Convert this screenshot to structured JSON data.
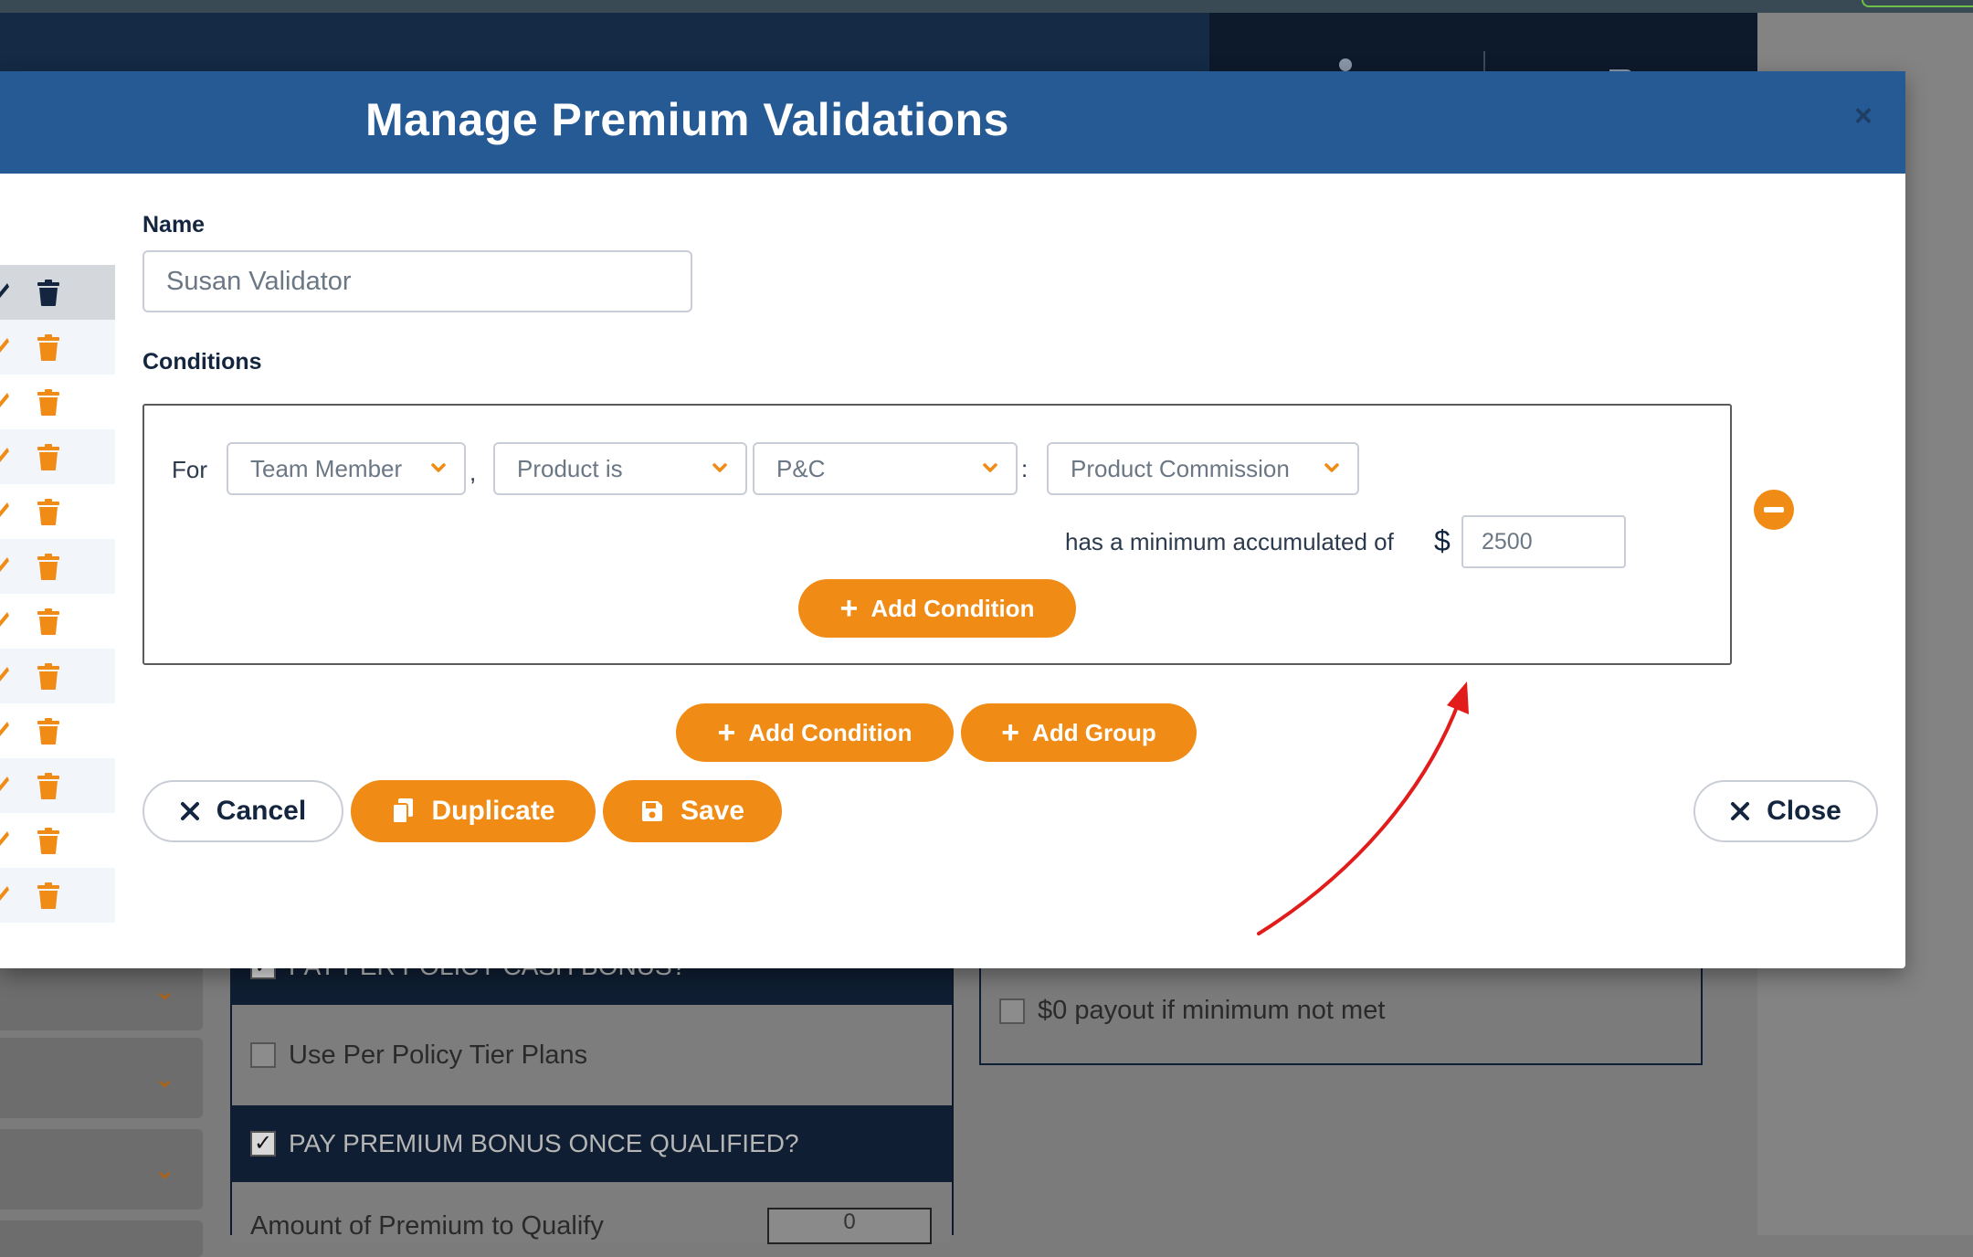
{
  "modal": {
    "title": "Manage Premium Validations",
    "close_x": "×"
  },
  "form": {
    "name_label": "Name",
    "name_value": "Susan Validator",
    "conditions_label": "Conditions"
  },
  "condition": {
    "for_label": "For",
    "comma": ",",
    "colon": ":",
    "subject_select": "Team Member",
    "product_op_select": "Product is",
    "product_select": "P&C",
    "metric_select": "Product Commission",
    "minimum_text": "has a minimum accumulated of",
    "currency": "$",
    "amount": "2500",
    "add_condition_inner": "Add Condition"
  },
  "actions": {
    "add_condition": "Add Condition",
    "add_group": "Add Group",
    "cancel": "Cancel",
    "duplicate": "Duplicate",
    "save": "Save",
    "close": "Close"
  },
  "list": {
    "row_count": 12,
    "selected_index": 0
  },
  "background": {
    "per_policy_cash_bonus": "PAY PER POLICY CASH BONUS?",
    "use_per_policy_tier_plans": "Use Per Policy Tier Plans",
    "pay_premium_bonus": "PAY PREMIUM BONUS ONCE QUALIFIED?",
    "amount_of_premium": "Amount of Premium to Qualify",
    "amount_value": "0",
    "zero_payout": "$0 payout if minimum not met"
  },
  "colors": {
    "header_blue": "#255a94",
    "accent_orange": "#f08b15",
    "annotation_red": "#e21b1b"
  }
}
